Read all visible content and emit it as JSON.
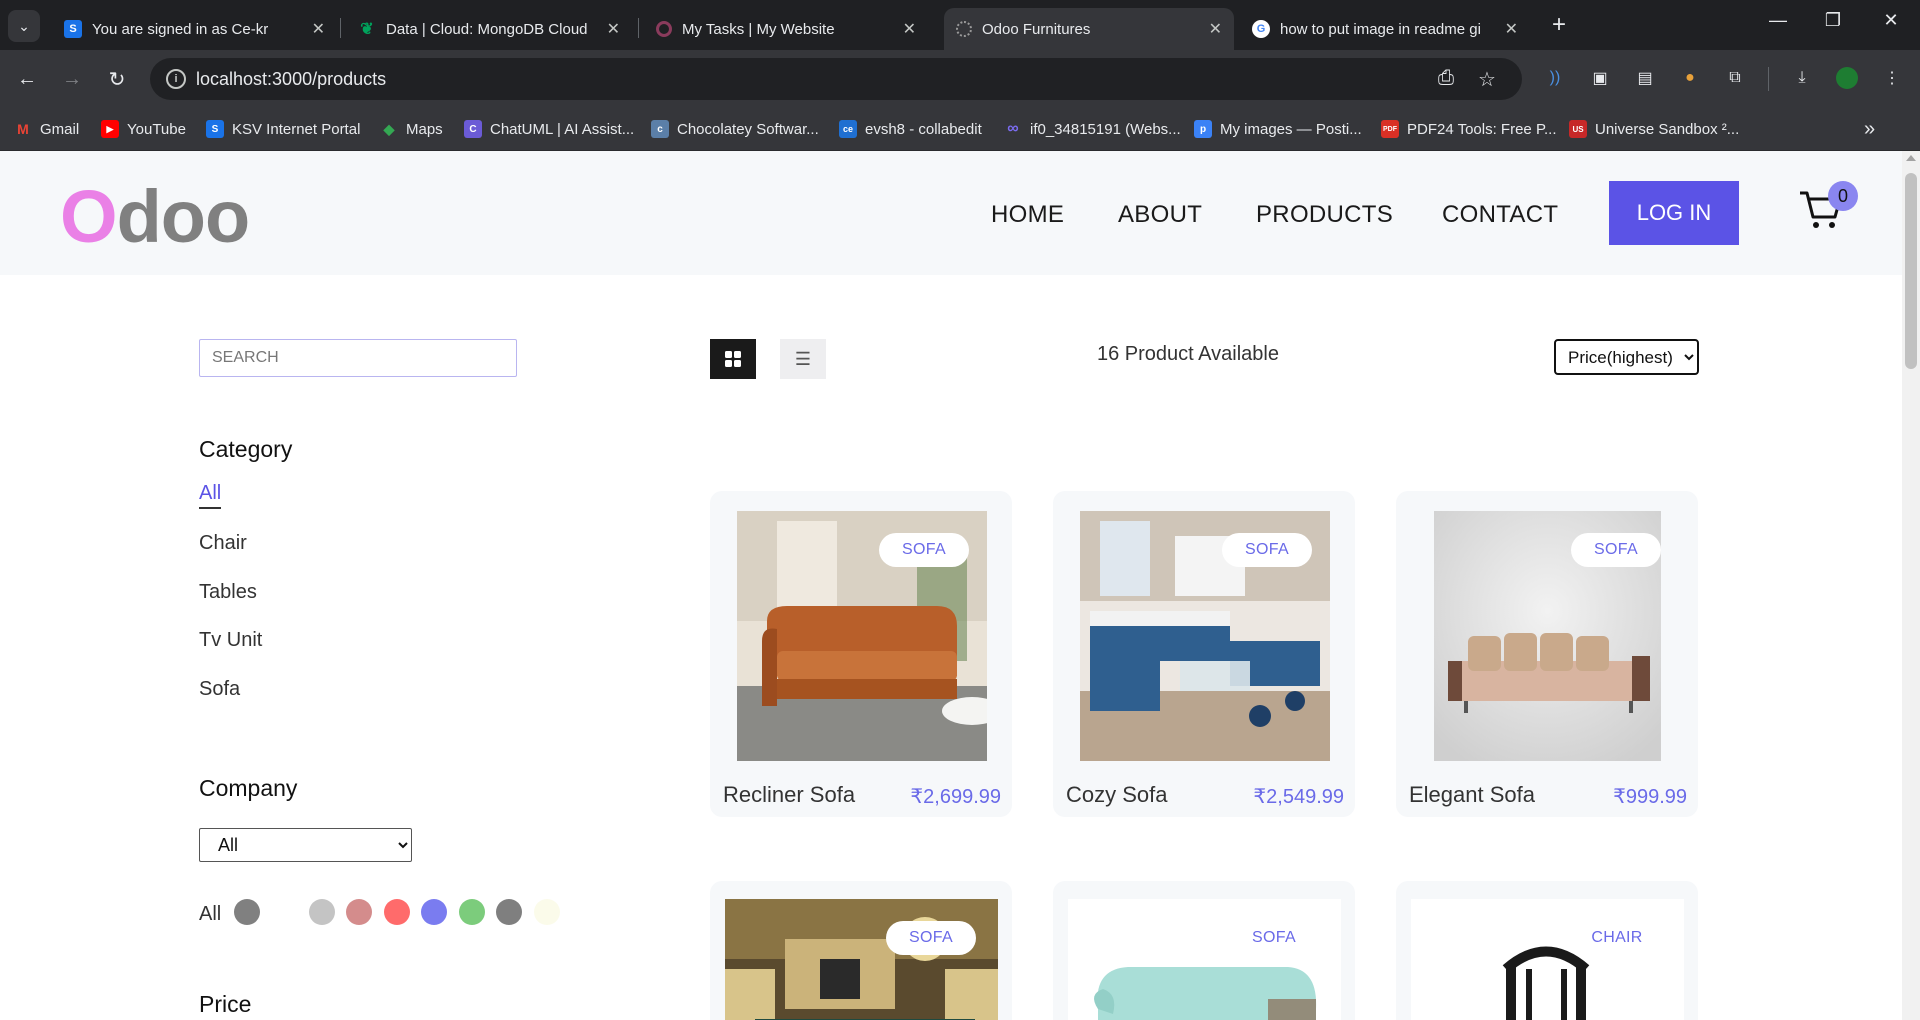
{
  "browser": {
    "tabs": [
      {
        "title": "You are signed in as Ce-kr",
        "favicon_color": "#1a73e8",
        "favicon_text": "S"
      },
      {
        "title": "Data | Cloud: MongoDB Cloud",
        "favicon_color": "#00a35c",
        "favicon_text": ""
      },
      {
        "title": "My Tasks | My Website",
        "favicon_color": "#8a3b5c",
        "favicon_text": ""
      },
      {
        "title": "Odoo Furnitures",
        "favicon_color": "#6b6b6b",
        "favicon_text": ""
      },
      {
        "title": "how to put image in readme gi",
        "favicon_color": "#ffffff",
        "favicon_text": "G"
      }
    ],
    "url": "localhost:3000/products",
    "bookmarks": [
      {
        "label": "Gmail",
        "color": "#ea4335",
        "text": "M"
      },
      {
        "label": "YouTube",
        "color": "#ff0000",
        "text": "▶"
      },
      {
        "label": "KSV Internet Portal",
        "color": "#1a73e8",
        "text": "S"
      },
      {
        "label": "Maps",
        "color": "#34a853",
        "text": "◆"
      },
      {
        "label": "ChatUML | AI Assist...",
        "color": "#6b5bd6",
        "text": "C"
      },
      {
        "label": "Chocolatey Softwar...",
        "color": "#5b7fa8",
        "text": "c"
      },
      {
        "label": "evsh8 - collabedit",
        "color": "#1f6fd1",
        "text": "ce"
      },
      {
        "label": "if0_34815191 (Webs...",
        "color": "#5b4fd8",
        "text": "∞"
      },
      {
        "label": "My images — Posti...",
        "color": "#3b82f6",
        "text": "p"
      },
      {
        "label": "PDF24 Tools: Free P...",
        "color": "#d93025",
        "text": "PDF"
      },
      {
        "label": "Universe Sandbox ²...",
        "color": "#c62828",
        "text": "US"
      }
    ]
  },
  "header": {
    "logo_first": "O",
    "logo_rest": "doo",
    "nav": [
      "HOME",
      "ABOUT",
      "PRODUCTS",
      "CONTACT"
    ],
    "login_label": "LOG IN",
    "cart_count": "0"
  },
  "filters": {
    "search_placeholder": "SEARCH",
    "category_heading": "Category",
    "categories": [
      "All",
      "Chair",
      "Tables",
      "Tv Unit",
      "Sofa"
    ],
    "active_category": "All",
    "company_heading": "Company",
    "company_selected": "All",
    "colors_label": "All",
    "colors": [
      "#808080",
      "#c4c4c4",
      "#d48c8c",
      "#ff6b6b",
      "#7a7cf0",
      "#7ccc7c",
      "#7f7f7f",
      "#fbfbea"
    ],
    "price_heading": "Price"
  },
  "toolbar": {
    "count_text": "16 Product Available",
    "sort_selected": "Price(highest)"
  },
  "products": [
    {
      "name": "Recliner Sofa",
      "price": "₹2,699.99",
      "category": "SOFA"
    },
    {
      "name": "Cozy Sofa",
      "price": "₹2,549.99",
      "category": "SOFA"
    },
    {
      "name": "Elegant Sofa",
      "price": "₹999.99",
      "category": "SOFA"
    },
    {
      "name": "",
      "price": "",
      "category": "SOFA"
    },
    {
      "name": "",
      "price": "",
      "category": "SOFA"
    },
    {
      "name": "",
      "price": "",
      "category": "CHAIR"
    }
  ]
}
